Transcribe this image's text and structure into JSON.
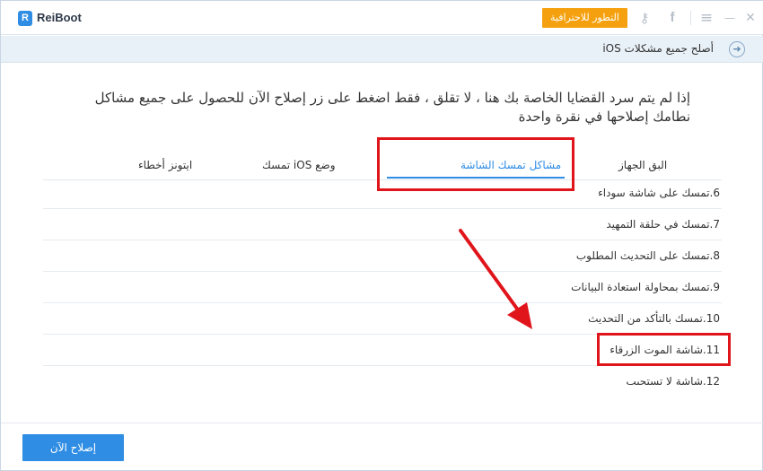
{
  "app": {
    "logo_letter": "R",
    "name": "ReiBoot"
  },
  "titlebar": {
    "pro_button_label": "التطور للاحترافية",
    "icons": [
      "key-icon",
      "facebook-icon",
      "menu-icon",
      "minimize-icon",
      "close-icon"
    ],
    "key_glyph": "⚷",
    "facebook_glyph": "f",
    "menu_glyph": "≡",
    "minimize_glyph": "—",
    "close_glyph": "✕"
  },
  "breadcrumb": {
    "back_glyph": "➜",
    "title": "أصلح جميع مشكلات iOS"
  },
  "main": {
    "heading": "إذا لم يتم سرد القضايا الخاصة بك هنا ، لا تقلق ، فقط اضغط على زر إصلاح الآن للحصول على جميع مشاكل نطامك إصلاحها في نقرة واحدة",
    "tabs": [
      {
        "label": "البق الجهاز",
        "active": false
      },
      {
        "label": "مشاكل تمسك الشاشة",
        "active": true
      },
      {
        "label": "وضع iOS تمسك",
        "active": false
      },
      {
        "label": "ايتونز أخطاء",
        "active": false
      }
    ],
    "issues": [
      "6.تمسك على شاشة سوداء",
      "7.تمسك في حلقة التمهيد",
      "8.تمسك على التحديث المطلوب",
      "9.تمسك بمحاولة استعادة البيانات",
      "10.تمسك بالتأكد من التحديث",
      "11.شاشة الموت الزرقاء",
      "12.شاشة لا تستجيب"
    ]
  },
  "footer": {
    "fix_now_label": "إصلاح الآن"
  },
  "colors": {
    "accent": "#2f8de4",
    "pro_orange": "#f5a10f",
    "highlight_red": "#e0151b"
  }
}
